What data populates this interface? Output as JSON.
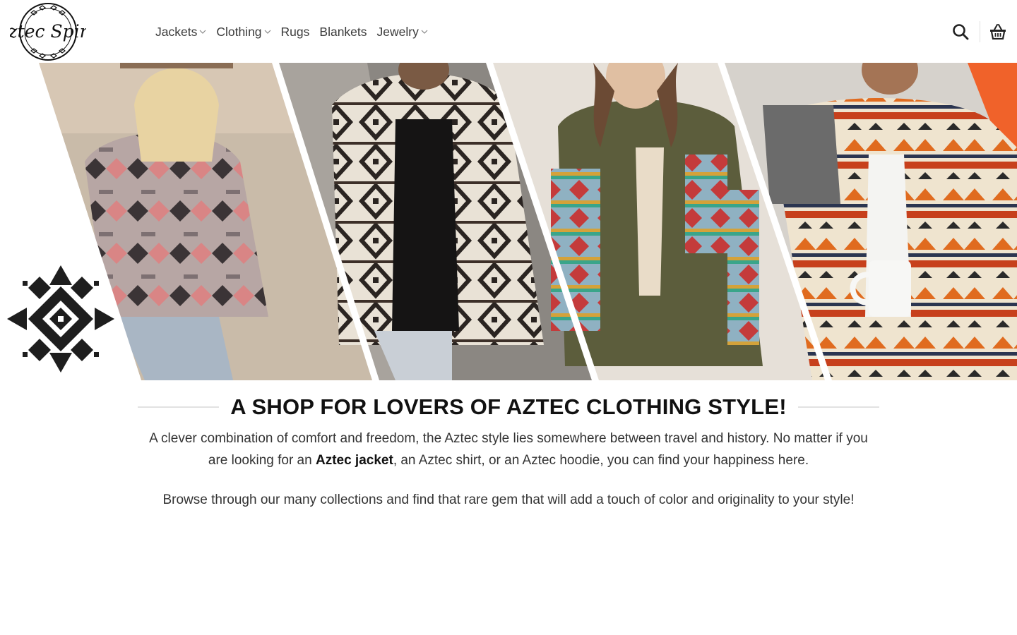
{
  "brand": {
    "logo_text": "Aztec Spirit"
  },
  "nav": {
    "items": [
      {
        "label": "Jackets",
        "has_dropdown": true
      },
      {
        "label": "Clothing",
        "has_dropdown": true
      },
      {
        "label": "Rugs",
        "has_dropdown": false
      },
      {
        "label": "Blankets",
        "has_dropdown": false
      },
      {
        "label": "Jewelry",
        "has_dropdown": true
      }
    ]
  },
  "header_icons": {
    "search": "search-icon",
    "cart": "basket-icon"
  },
  "banner": {
    "panels": [
      "woman-pink-aztec-jacket",
      "man-black-white-aztec-jacket",
      "woman-green-aztec-shirt",
      "man-aztec-cardigan"
    ],
    "ornament": "aztec-star-ornament"
  },
  "main": {
    "title": "A SHOP FOR LOVERS OF AZTEC CLOTHING STYLE!",
    "intro_before": "A clever combination of comfort and freedom, the Aztec style lies somewhere between travel and history. No matter if you are looking for an ",
    "intro_link": "Aztec jacket",
    "intro_after": ", an Aztec shirt, or an Aztec hoodie, you can find your happiness here.",
    "browse_text": "Browse through our many collections and find that rare gem that will add a touch of color and originality to your style!"
  },
  "colors": {
    "text": "#1a1a1a",
    "nav_text": "#3a3a3a",
    "rule": "#e2e2e2",
    "accent_orange": "#e8561c"
  }
}
